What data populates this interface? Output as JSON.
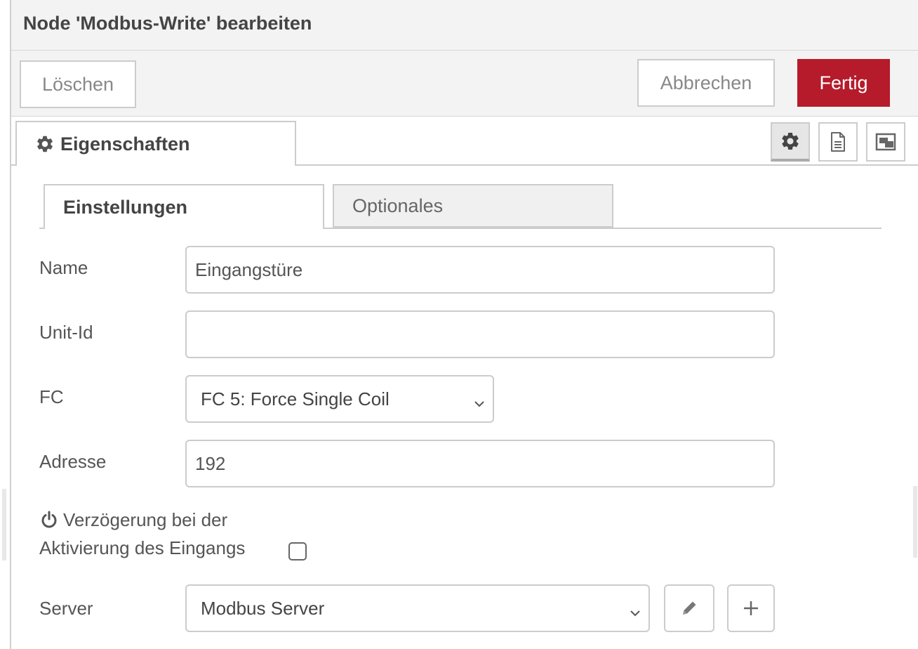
{
  "dialog": {
    "title": "Node 'Modbus-Write' bearbeiten"
  },
  "toolbar": {
    "delete_label": "Löschen",
    "cancel_label": "Abbrechen",
    "done_label": "Fertig"
  },
  "tabs": {
    "properties_label": "Eigenschaften",
    "icons": [
      "gear-icon",
      "document-icon",
      "appearance-icon"
    ]
  },
  "inner_tabs": {
    "settings_label": "Einstellungen",
    "optional_label": "Optionales"
  },
  "form": {
    "name_label": "Name",
    "name_value": "Eingangstüre",
    "unit_label": "Unit-Id",
    "unit_value": "",
    "fc_label": "FC",
    "fc_value": "FC 5: Force Single Coil",
    "address_label": "Adresse",
    "address_value": "192",
    "delay_label_line1": "Verzögerung bei der",
    "delay_label_line2": "Aktivierung des Eingangs",
    "delay_checked": false,
    "server_label": "Server",
    "server_value": "Modbus Server"
  },
  "colors": {
    "primary_button": "#b51b2b",
    "panel_background": "#f3f3f3",
    "border": "#cccccc"
  }
}
